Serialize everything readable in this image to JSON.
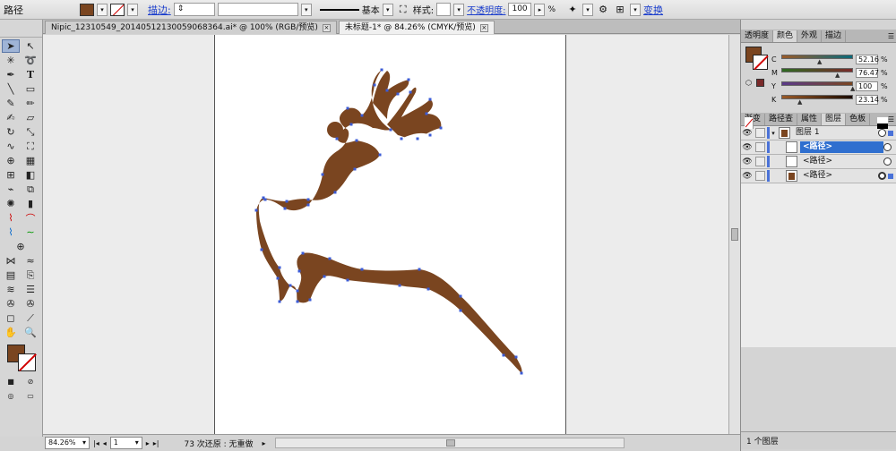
{
  "control_bar": {
    "selection_label": "路径",
    "fill_color": "#7a4520",
    "stroke_link": "描边:",
    "stroke_line_label": "基本",
    "style_label": "样式:",
    "opacity_link": "不透明度:",
    "opacity_value": "100",
    "opacity_unit": "%",
    "transform_link": "变换"
  },
  "tabs": [
    {
      "label": "Nipic_12310549_20140512130059068364.ai* @ 100% (RGB/预览)",
      "active": false
    },
    {
      "label": "未标题-1* @ 84.26% (CMYK/预览)",
      "active": true
    }
  ],
  "status_bar": {
    "zoom": "84.26%",
    "page": "1",
    "history": "73 次还原 : 无重做"
  },
  "color_panel": {
    "tabs": [
      "透明度",
      "颜色",
      "外观",
      "描边"
    ],
    "active_tab": "颜色",
    "fill_color": "#7a4520",
    "channels": [
      {
        "label": "C",
        "value": "52.16"
      },
      {
        "label": "M",
        "value": "76.47"
      },
      {
        "label": "Y",
        "value": "100"
      },
      {
        "label": "K",
        "value": "23.14"
      }
    ],
    "unit": "%"
  },
  "layers_panel": {
    "tabs": [
      "渐变",
      "路径查",
      "属性",
      "图层",
      "色板"
    ],
    "active_tab": "图层",
    "rows": [
      {
        "name": "图层 1",
        "level": 0,
        "selected": false
      },
      {
        "name": "<路径>",
        "level": 1,
        "selected": true
      },
      {
        "name": "<路径>",
        "level": 1,
        "selected": false
      },
      {
        "name": "<路径>",
        "level": 1,
        "selected": false
      }
    ],
    "footer": "1 个图层"
  },
  "artwork": {
    "fill_color": "#7a4520",
    "anchor_color": "#3b5bd6"
  }
}
